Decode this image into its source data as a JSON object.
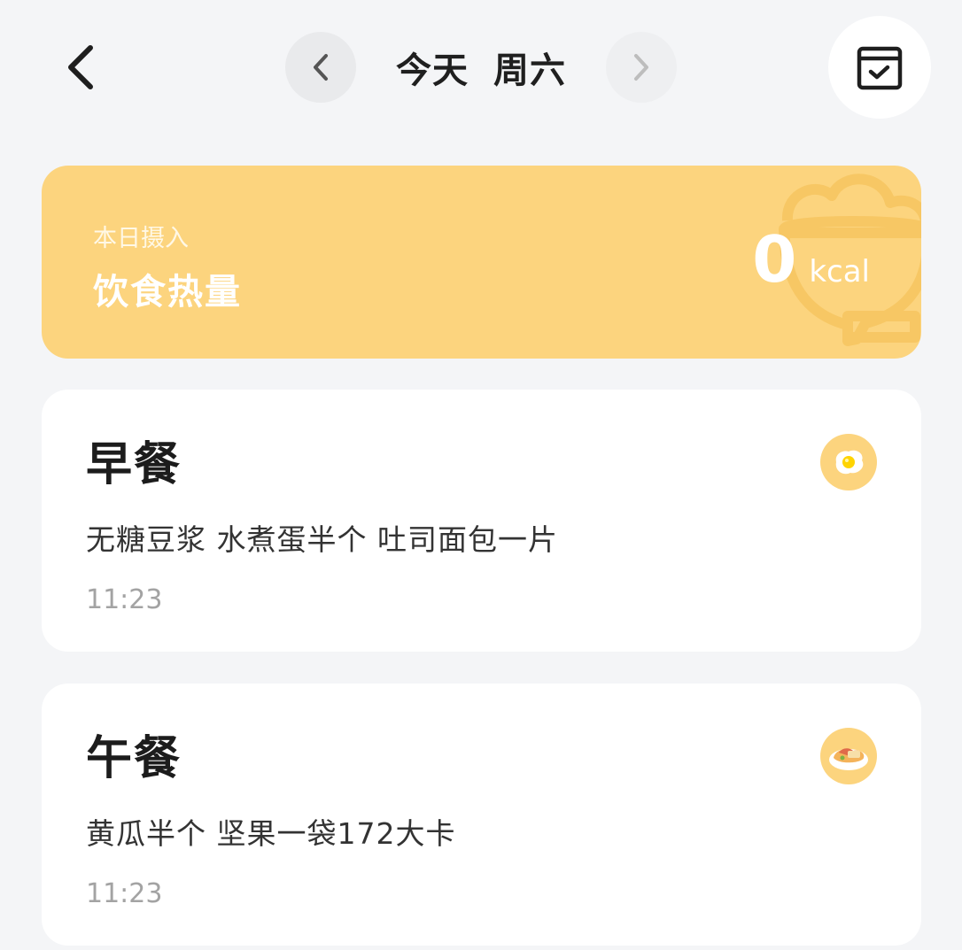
{
  "header": {
    "day_label": "今天",
    "weekday_label": "周六",
    "icons": {
      "back": "chevron-left-icon",
      "prev_day": "chevron-left-icon",
      "next_day": "chevron-right-icon",
      "calendar": "calendar-check-icon"
    }
  },
  "summary": {
    "subtitle": "本日摄入",
    "title": "饮食热量",
    "value": "0",
    "unit": "kcal",
    "color": "#fcd47e"
  },
  "meals": [
    {
      "title": "早餐",
      "description": "无糖豆浆 水煮蛋半个 吐司面包一片",
      "time": "11:23",
      "icon": "fried-egg-icon"
    },
    {
      "title": "午餐",
      "description": "黄瓜半个 坚果一袋172大卡",
      "time": "11:23",
      "icon": "lunch-plate-icon"
    }
  ]
}
